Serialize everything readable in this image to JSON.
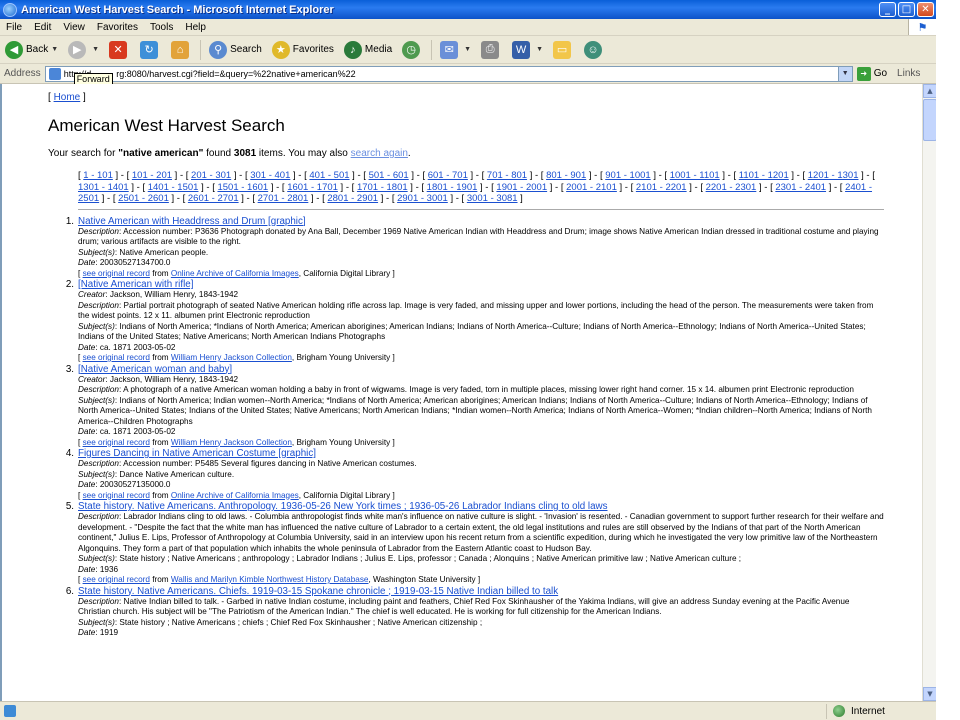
{
  "window": {
    "title": "American West Harvest Search - Microsoft Internet Explorer",
    "minimize": "_",
    "maximize": "□",
    "close": "✕"
  },
  "menu": [
    "File",
    "Edit",
    "View",
    "Favorites",
    "Tools",
    "Help"
  ],
  "toolbar": {
    "back": "Back",
    "search": "Search",
    "favorites": "Favorites",
    "media": "Media"
  },
  "address": {
    "label": "Address",
    "url": "http://d          rg:8080/harvest.cgi?field=&query=%22native+american%22",
    "tooltip": "Forward",
    "go": "Go",
    "links": "Links"
  },
  "page": {
    "home_open": "[ ",
    "home_link": "Home",
    "home_close": " ]",
    "title": "American West Harvest Search",
    "summary_pre": "Your search for ",
    "query": "\"native american\"",
    "summary_mid": " found ",
    "count": "3081",
    "summary_post": " items. You may also ",
    "search_again": "search again",
    "summary_end": ".",
    "pager": [
      "1 - 101",
      "101 - 201",
      "201 - 301",
      "301 - 401",
      "401 - 501",
      "501 - 601",
      "601 - 701",
      "701 - 801",
      "801 - 901",
      "901 - 1001",
      "1001 - 1101",
      "1101 - 1201",
      "1201 - 1301",
      "1301 - 1401",
      "1401 - 1501",
      "1501 - 1601",
      "1601 - 1701",
      "1701 - 1801",
      "1801 - 1901",
      "1901 - 2001",
      "2001 - 2101",
      "2101 - 2201",
      "2201 - 2301",
      "2301 - 2401",
      "2401 - 2501",
      "2501 - 2601",
      "2601 - 2701",
      "2701 - 2801",
      "2801 - 2901",
      "2901 - 3001",
      "3001 - 3081"
    ]
  },
  "results": [
    {
      "num": "1.",
      "title": "Native American with Headdress and Drum [graphic]",
      "fields": [
        {
          "label": "Description",
          "value": "Accession number: P3636 Photograph donated by Ana Ball, December 1969 Native American Indian with Headdress and Drum; image shows Native American Indian dressed in traditional costume and playing drum; various artifacts are visible to the right."
        },
        {
          "label": "Subject(s)",
          "value": "Native American people."
        },
        {
          "label": "Date",
          "value": "20030527134700.0"
        }
      ],
      "record_link": "see original record",
      "from": " from ",
      "collection": "Online Archive of California Images",
      "institution": ", California Digital Library ]"
    },
    {
      "num": "2.",
      "title": "[Native American with rifle]",
      "fields": [
        {
          "label": "Creator",
          "value": "Jackson, William Henry, 1843-1942"
        },
        {
          "label": "Description",
          "value": "Partial portrait photograph of seated Native American holding rifle across lap. Image is very faded, and missing upper and lower portions, including the head of the person. The measurements were taken from the widest points. 12 x 11. albumen print Electronic reproduction"
        },
        {
          "label": "Subject(s)",
          "value": "Indians of North America; *Indians of North America; American aborigines; American Indians; Indians of North America--Culture; Indians of North America--Ethnology; Indians of North America--United States; Indians of the United States; Native Americans; North American Indians Photographs"
        },
        {
          "label": "Date",
          "value": "ca. 1871 2003-05-02"
        }
      ],
      "record_link": "see original record",
      "from": " from ",
      "collection": "William Henry Jackson Collection",
      "institution": ", Brigham Young University ]"
    },
    {
      "num": "3.",
      "title": "[Native American woman and baby]",
      "fields": [
        {
          "label": "Creator",
          "value": "Jackson, William Henry, 1843-1942"
        },
        {
          "label": "Description",
          "value": "A photograph of a native American woman holding a baby in front of wigwams. Image is very faded, torn in multiple places, missing lower right hand corner. 15 x 14. albumen print Electronic reproduction"
        },
        {
          "label": "Subject(s)",
          "value": "Indians of North America; Indian women--North America; *Indians of North America; American aborigines; American Indians; Indians of North America--Culture; Indians of North America--Ethnology; Indians of North America--United States; Indians of the United States; Native Americans; North American Indians; *Indian women--North America; Indians of North America--Women; *Indian children--North America; Indians of North America--Children Photographs"
        },
        {
          "label": "Date",
          "value": "ca. 1871 2003-05-02"
        }
      ],
      "record_link": "see original record",
      "from": " from ",
      "collection": "William Henry Jackson Collection",
      "institution": ", Brigham Young University ]"
    },
    {
      "num": "4.",
      "title": "Figures Dancing in Native American Costume [graphic]",
      "fields": [
        {
          "label": "Description",
          "value": "Accession number: P5485 Several figures dancing in Native American costumes."
        },
        {
          "label": "Subject(s)",
          "value": "Dance Native American culture."
        },
        {
          "label": "Date",
          "value": "20030527135000.0"
        }
      ],
      "record_link": "see original record",
      "from": " from ",
      "collection": "Online Archive of California Images",
      "institution": ", California Digital Library ]"
    },
    {
      "num": "5.",
      "title": "State history. Native Americans. Anthropology. 1936-05-26 New York times ; 1936-05-26 Labrador Indians cling to old laws",
      "fields": [
        {
          "label": "Description",
          "value": "Labrador Indians cling to old laws. - Columbia anthropologist finds white man's influence on native culture is slight. - 'Invasion' is resented. - Canadian government to support further research for their welfare and development. - \"Despite the fact that the white man has influenced the native culture of Labrador to a certain extent, the old legal institutions and rules are still observed by the Indians of that part of the North American continent,\" Julius E. Lips, Professor of Anthropology at Columbia University, said in an interview upon his recent return from a scientific expedition, during which he investigated the very low primitive law of the Northeastern Algonquins. They form a part of that population which inhabits the whole peninsula of Labrador from the Eastern Atlantic coast to Hudson Bay."
        },
        {
          "label": "Subject(s)",
          "value": "State history ; Native Americans ; anthropology ; Labrador Indians ; Julius E. Lips, professor ; Canada ; Alonquins ; Native American primitive law ; Native American culture ;"
        },
        {
          "label": "Date",
          "value": "1936"
        }
      ],
      "record_link": "see original record",
      "from": " from ",
      "collection": "Wallis and Marilyn Kimble Northwest History Database",
      "institution": ", Washington State University ]"
    },
    {
      "num": "6.",
      "title": "State history. Native Americans. Chiefs. 1919-03-15 Spokane chronicle ; 1919-03-15 Native Indian billed to talk",
      "fields": [
        {
          "label": "Description",
          "value": "Native Indian billed to talk. - Garbed in native Indian costume, including paint and feathers, Chief Red Fox Skinhausher of the Yakima Indians, will give an address Sunday evening at the Pacific Avenue Christian church. His subject will be \"The Patriotism of the American Indian.\" The chief is well educated. He is working for full citizenship for the American Indians."
        },
        {
          "label": "Subject(s)",
          "value": "State history ; Native Americans ; chiefs ; Chief Red Fox Skinhausher ; Native American citizenship ;"
        },
        {
          "label": "Date",
          "value": "1919"
        }
      ],
      "record_link": "",
      "from": "",
      "collection": "",
      "institution": ""
    }
  ],
  "status": {
    "zone": "Internet"
  }
}
